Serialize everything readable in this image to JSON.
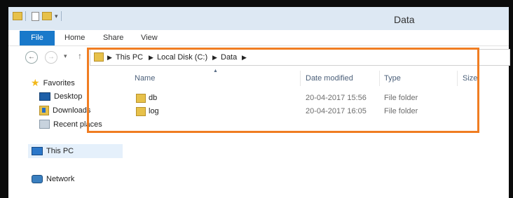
{
  "window": {
    "title": "Data"
  },
  "ribbon": {
    "tabs": [
      "File",
      "Home",
      "Share",
      "View"
    ]
  },
  "address": {
    "crumbs": [
      "This PC",
      "Local Disk (C:)",
      "Data"
    ]
  },
  "nav": {
    "favorites": "Favorites",
    "desktop": "Desktop",
    "downloads": "Downloads",
    "recent": "Recent places",
    "this_pc": "This PC",
    "network": "Network"
  },
  "columns": {
    "name": "Name",
    "date": "Date modified",
    "type": "Type",
    "size": "Size"
  },
  "files": [
    {
      "name": "db",
      "date": "20-04-2017 15:56",
      "type": "File folder"
    },
    {
      "name": "log",
      "date": "20-04-2017 16:05",
      "type": "File folder"
    }
  ],
  "colors": {
    "accent": "#1979ca",
    "highlight": "#f07d22"
  }
}
